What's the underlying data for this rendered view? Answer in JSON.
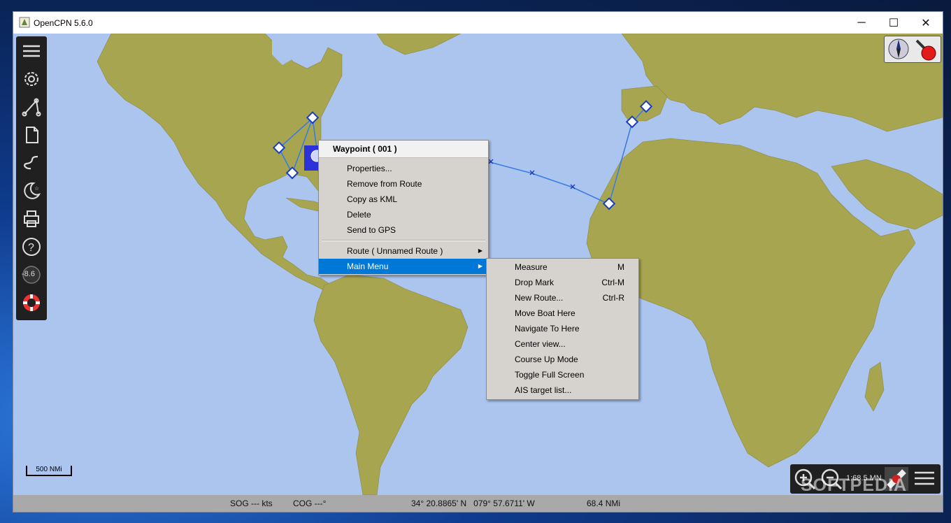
{
  "window": {
    "title": "OpenCPN 5.6.0",
    "minimize_glyph": "─",
    "maximize_glyph": "☐",
    "close_glyph": "✕"
  },
  "toolbar": {
    "items": [
      {
        "name": "hamburger-menu-icon"
      },
      {
        "name": "settings-gear-icon"
      },
      {
        "name": "route-tool-icon"
      },
      {
        "name": "route-manager-icon"
      },
      {
        "name": "track-icon"
      },
      {
        "name": "night-mode-icon"
      },
      {
        "name": "print-icon"
      },
      {
        "name": "help-icon"
      },
      {
        "name": "tide-current-icon",
        "label": "-8.6"
      },
      {
        "name": "mob-lifebuoy-icon"
      }
    ]
  },
  "scalebar": {
    "label": "500 NMi"
  },
  "zoom": {
    "scale_label": "1:68.5 MN"
  },
  "status": {
    "sog": "SOG --- kts",
    "cog": "COG ---°",
    "position": "34° 20.8865' N   079° 57.6711' W",
    "distance": "68.4 NMi"
  },
  "context_menu": {
    "header": "Waypoint ( 001 )",
    "items": [
      "Properties...",
      "Remove from Route",
      "Copy as KML",
      "Delete",
      "Send to GPS"
    ],
    "route_item": "Route ( Unnamed Route )",
    "main_menu_item": "Main Menu"
  },
  "submenu": {
    "items": [
      {
        "label": "Measure",
        "accel": "M"
      },
      {
        "label": "Drop Mark",
        "accel": "Ctrl-M"
      },
      {
        "label": "New Route...",
        "accel": "Ctrl-R"
      },
      {
        "label": "Move Boat Here",
        "accel": ""
      },
      {
        "label": "Navigate To Here",
        "accel": ""
      },
      {
        "label": "Center view...",
        "accel": ""
      },
      {
        "label": "Course Up Mode",
        "accel": ""
      },
      {
        "label": "Toggle Full Screen",
        "accel": ""
      },
      {
        "label": "AIS target list...",
        "accel": ""
      }
    ]
  },
  "watermark": "SOFTPEDIA",
  "colors": {
    "sea": "#abc5ee",
    "land": "#a7a550",
    "route": "#3b7de0",
    "menu_highlight": "#0078d7"
  }
}
